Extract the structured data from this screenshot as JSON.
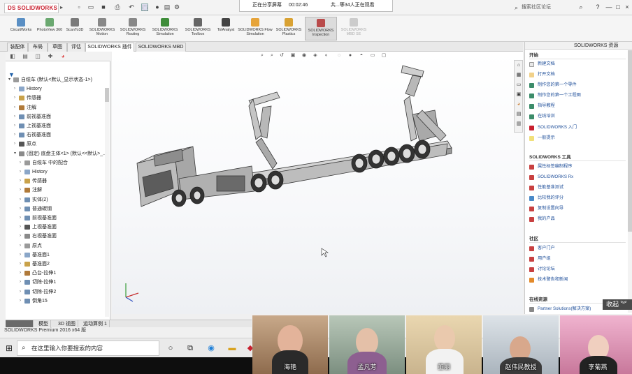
{
  "titlebar": {
    "logo_text": "DS SOLIDWORKS",
    "share_status": "正在分享屏幕",
    "share_time": "00:02:46",
    "viewers": "共...等34人正在观看",
    "search_placeholder": "搜索社区论坛",
    "help": "?",
    "minimize": "—",
    "restore": "□",
    "close": "×"
  },
  "command_manager": [
    {
      "label": "CircuitWorks"
    },
    {
      "label": "PhotoView 360"
    },
    {
      "label": "ScanTo3D"
    },
    {
      "label": "SOLIDWORKS Motion"
    },
    {
      "label": "SOLIDWORKS Routing"
    },
    {
      "label": "SOLIDWORKS Simulation"
    },
    {
      "label": "SOLIDWORKS Toolbox"
    },
    {
      "label": "TolAnalyst"
    },
    {
      "label": "SOLIDWORKS Flow Simulation"
    },
    {
      "label": "SOLIDWORKS Plastics"
    },
    {
      "label": "SOLIDWORKS Inspection"
    },
    {
      "label": "SOLIDWORKS MBD SE"
    }
  ],
  "tabs": [
    "装配体",
    "布局",
    "草图",
    "评估",
    "SOLIDWORKS 插件",
    "SOLIDWORKS MBD"
  ],
  "feature_tree": [
    {
      "label": "自缆车 (默认<默认_显示状态-1>)",
      "indent": 0
    },
    {
      "label": "History",
      "indent": 1
    },
    {
      "label": "传感器",
      "indent": 1
    },
    {
      "label": "注解",
      "indent": 1
    },
    {
      "label": "前视基准面",
      "indent": 1
    },
    {
      "label": "上视基准面",
      "indent": 1
    },
    {
      "label": "右视基准面",
      "indent": 1
    },
    {
      "label": "原点",
      "indent": 1
    },
    {
      "label": "(固定) 底盘主体<1> (默认<<默认>_...",
      "indent": 1
    },
    {
      "label": "自缆车 中的配合",
      "indent": 2
    },
    {
      "label": "History",
      "indent": 2
    },
    {
      "label": "传感器",
      "indent": 2
    },
    {
      "label": "注解",
      "indent": 2
    },
    {
      "label": "实体(2)",
      "indent": 2
    },
    {
      "label": "普通碳钢",
      "indent": 2
    },
    {
      "label": "前视基准面",
      "indent": 2
    },
    {
      "label": "上视基准面",
      "indent": 2
    },
    {
      "label": "右视基准面",
      "indent": 2
    },
    {
      "label": "原点",
      "indent": 2
    },
    {
      "label": "基准面1",
      "indent": 2
    },
    {
      "label": "基准面2",
      "indent": 2
    },
    {
      "label": "凸台-拉伸1",
      "indent": 2
    },
    {
      "label": "切除-拉伸1",
      "indent": 2
    },
    {
      "label": "切除-拉伸2",
      "indent": 2
    },
    {
      "label": "倒角15",
      "indent": 2
    }
  ],
  "bottom_tabs": [
    "模型",
    "3D 视图",
    "运动算例 1"
  ],
  "status": "SOLIDWORKS Premium 2016 x64 版",
  "task_pane": {
    "title": "SOLIDWORKS 资源",
    "sections": [
      {
        "title": "开始",
        "items": [
          "新建文档",
          "打开文档",
          "制作您的第一个零件",
          "制作您的第一个工程图",
          "指导教程",
          "在线培训",
          "SOLIDWORKS 入门",
          "一般提示"
        ]
      },
      {
        "title": "SOLIDWORKS 工具",
        "items": [
          "属性标签编制程序",
          "SOLIDWORKS Rx",
          "性能基准测试",
          "比较我的评分",
          "复制设置向导",
          "我的产品"
        ]
      },
      {
        "title": "社区",
        "items": [
          "客户门户",
          "用户组",
          "讨论论坛",
          "技术警告和新闻"
        ]
      },
      {
        "title": "在线资源",
        "items": [
          "Partner Solutions(解决方案)"
        ]
      }
    ]
  },
  "collapse_label": "收起",
  "taskbar": {
    "search_placeholder": "在这里输入你要搜索的内容"
  },
  "participants": [
    "海艳",
    "孟凡芳",
    "董丽",
    "赵伟民教授",
    "李菊燕"
  ]
}
